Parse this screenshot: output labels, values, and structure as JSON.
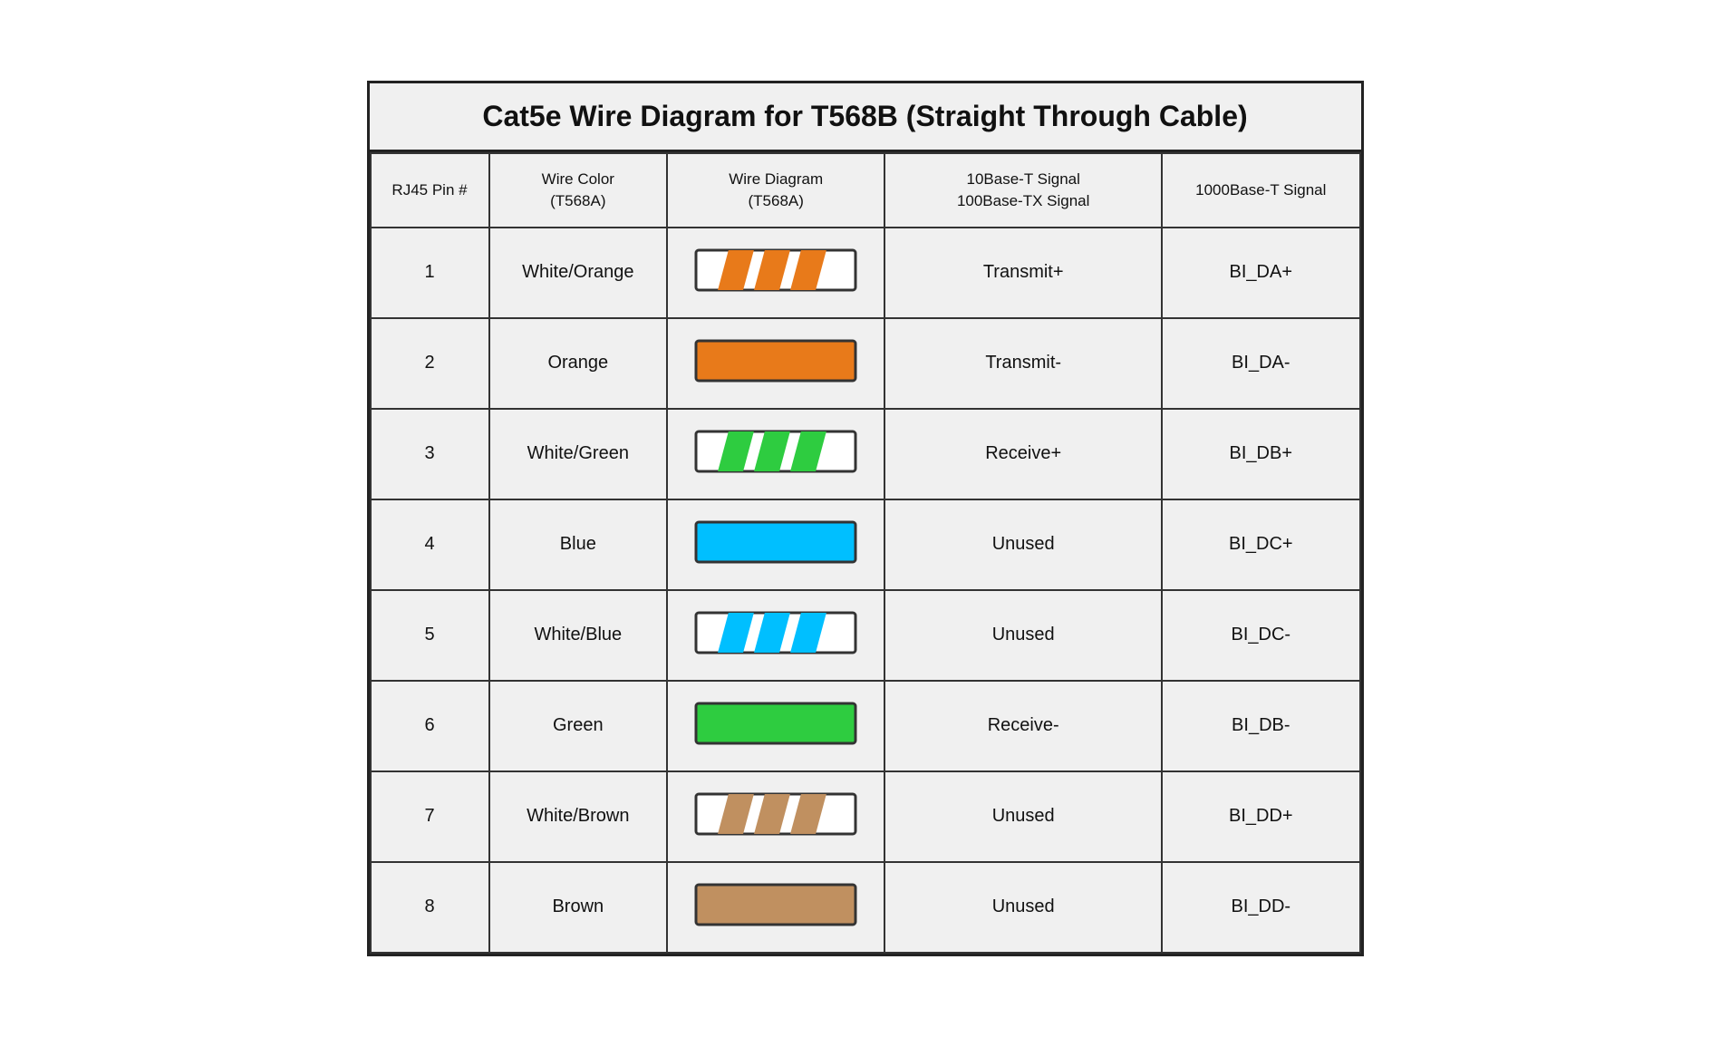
{
  "title": "Cat5e Wire Diagram for T568B (Straight Through Cable)",
  "headers": {
    "pin": "RJ45 Pin #",
    "color": "Wire Color\n(T568A)",
    "diagram": "Wire Diagram\n(T568A)",
    "signal_10_100": "10Base-T Signal\n100Base-TX Signal",
    "signal_1000": "1000Base-T Signal"
  },
  "rows": [
    {
      "pin": "1",
      "color": "White/Orange",
      "wire_type": "striped",
      "wire_color": "#E87A1A",
      "signal_10_100": "Transmit+",
      "signal_1000": "BI_DA+"
    },
    {
      "pin": "2",
      "color": "Orange",
      "wire_type": "solid",
      "wire_color": "#E87A1A",
      "signal_10_100": "Transmit-",
      "signal_1000": "BI_DA-"
    },
    {
      "pin": "3",
      "color": "White/Green",
      "wire_type": "striped",
      "wire_color": "#2ECC40",
      "signal_10_100": "Receive+",
      "signal_1000": "BI_DB+"
    },
    {
      "pin": "4",
      "color": "Blue",
      "wire_type": "solid",
      "wire_color": "#00BFFF",
      "signal_10_100": "Unused",
      "signal_1000": "BI_DC+"
    },
    {
      "pin": "5",
      "color": "White/Blue",
      "wire_type": "striped",
      "wire_color": "#00BFFF",
      "signal_10_100": "Unused",
      "signal_1000": "BI_DC-"
    },
    {
      "pin": "6",
      "color": "Green",
      "wire_type": "solid",
      "wire_color": "#2ECC40",
      "signal_10_100": "Receive-",
      "signal_1000": "BI_DB-"
    },
    {
      "pin": "7",
      "color": "White/Brown",
      "wire_type": "striped",
      "wire_color": "#C09060",
      "signal_10_100": "Unused",
      "signal_1000": "BI_DD+"
    },
    {
      "pin": "8",
      "color": "Brown",
      "wire_type": "solid",
      "wire_color": "#C09060",
      "signal_10_100": "Unused",
      "signal_1000": "BI_DD-"
    }
  ]
}
